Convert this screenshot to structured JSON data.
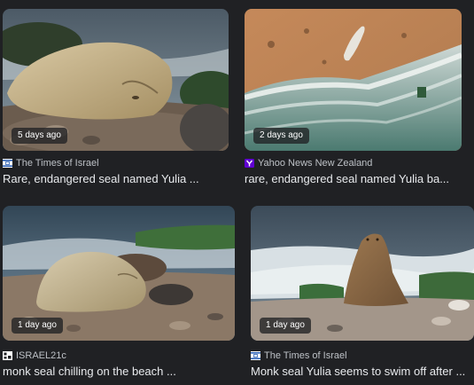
{
  "cards": [
    {
      "age": "5 days ago",
      "source": "The Times of Israel",
      "source_icon": "times-of-israel-logo-icon",
      "title": "Rare, endangered seal named Yulia ..."
    },
    {
      "age": "2 days ago",
      "source": "Yahoo News New Zealand",
      "source_icon": "yahoo-logo-icon",
      "title": "rare, endangered seal named Yulia ba..."
    },
    {
      "age": "1 day ago",
      "source": "ISRAEL21c",
      "source_icon": "israel21c-logo-icon",
      "title": "monk seal chilling on the beach ..."
    },
    {
      "age": "1 day ago",
      "source": "The Times of Israel",
      "source_icon": "times-of-israel-logo-icon",
      "title": "Monk seal Yulia seems to swim off after ..."
    }
  ],
  "colors": {
    "page_background": "#202124",
    "title_text": "#e8eaed",
    "source_text": "#bdc1c6",
    "yahoo_purple": "#6001d2",
    "times_blue": "#2b5fb4"
  }
}
